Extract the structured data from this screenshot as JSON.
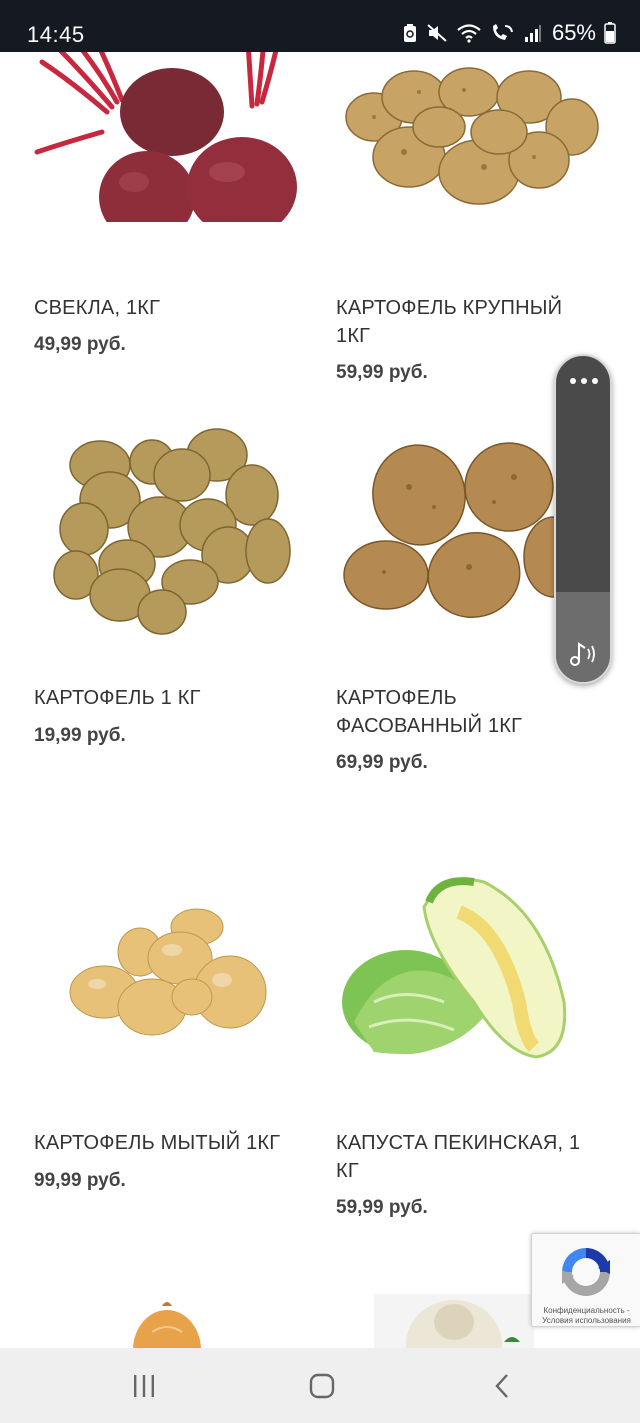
{
  "status_bar": {
    "time": "14:45",
    "battery_percent": "65%",
    "icons": [
      "recycle-icon",
      "mute-icon",
      "wifi-icon",
      "wifi-call-icon",
      "signal-icon",
      "battery-icon"
    ]
  },
  "products": [
    {
      "name": "СВЕКЛА, 1КГ",
      "price": "49,99 руб.",
      "image": "beet-image"
    },
    {
      "name": "КАРТОФЕЛЬ КРУПНЫЙ 1КГ",
      "price": "59,99 руб.",
      "image": "large-potato-image"
    },
    {
      "name": "КАРТОФЕЛЬ 1 КГ",
      "price": "19,99 руб.",
      "image": "potato-pile-image"
    },
    {
      "name": "КАРТОФЕЛЬ ФАСОВАННЫЙ 1КГ",
      "price": "69,99 руб.",
      "image": "packed-potato-image"
    },
    {
      "name": "КАРТОФЕЛЬ МЫТЫЙ 1КГ",
      "price": "99,99 руб.",
      "image": "washed-potato-image"
    },
    {
      "name": "КАПУСТА ПЕКИНСКАЯ, 1 КГ",
      "price": "59,99 руб.",
      "image": "napa-cabbage-image"
    }
  ],
  "recaptcha": {
    "text_line1": "Конфиденциальность -",
    "text_line2": "Условия использования"
  },
  "colors": {
    "status_bar_bg": "#151a22",
    "text": "#333333",
    "nav_bg": "#efefef"
  }
}
